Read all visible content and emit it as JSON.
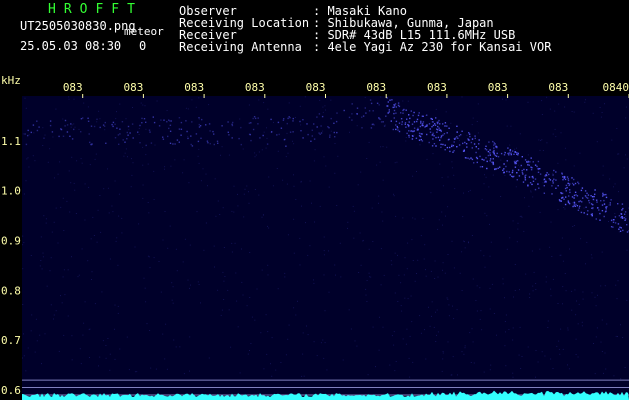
{
  "header": {
    "app_name": "HROFFT",
    "filename": "UT2505030830.png",
    "meteor_label": "meteor",
    "datetime": "25.05.03 08:30",
    "meteor_count": "0",
    "observer_label": "Observer",
    "observer_value": ": Masaki Kano",
    "location_label": "Receiving Location",
    "location_value": ": Shibukawa, Gunma, Japan",
    "receiver_label": "Receiver",
    "receiver_value": ": SDR# 43dB L15 111.6MHz USB",
    "antenna_label": "Receiving Antenna",
    "antenna_value": ": 4ele Yagi Az 230 for Kansai VOR"
  },
  "colors": {
    "background": "#000000",
    "plot_bg": "#00002a",
    "header_text": "#ffffff",
    "app_name": "#33ff33",
    "tick_labels": "#ffffaa",
    "signal": "#5a5aff",
    "noise_floor": "#33ffff",
    "reference_lines": "#8080c0"
  },
  "chart_data": {
    "type": "heatmap",
    "ylabel": "kHz",
    "x_tick_labels": [
      "083",
      "083",
      "083",
      "083",
      "083",
      "083",
      "083",
      "083",
      "083",
      "0840"
    ],
    "y_ticks": [
      1.1,
      1.0,
      0.9,
      0.8,
      0.7,
      0.6
    ],
    "y_tick_labels": [
      "1.1",
      "1.0",
      "0.9",
      "0.8",
      "0.7",
      "0.6"
    ],
    "ylim": [
      0.58,
      1.19
    ],
    "reference_lines_khz": [
      0.62,
      0.605,
      0.59
    ],
    "signal_trace": {
      "x_minutes": [
        0.0,
        0.8,
        1.5,
        2.5,
        3.5,
        4.5,
        5.5,
        6.0,
        6.5,
        7.0,
        7.5,
        8.0,
        8.5,
        9.0,
        9.5,
        10.0
      ],
      "y_khz": [
        1.12,
        1.12,
        1.12,
        1.12,
        1.12,
        1.12,
        1.15,
        1.16,
        1.13,
        1.11,
        1.08,
        1.06,
        1.03,
        1.0,
        0.97,
        0.94
      ]
    },
    "xlim": [
      0,
      10
    ],
    "grid": false,
    "legend": "none"
  }
}
